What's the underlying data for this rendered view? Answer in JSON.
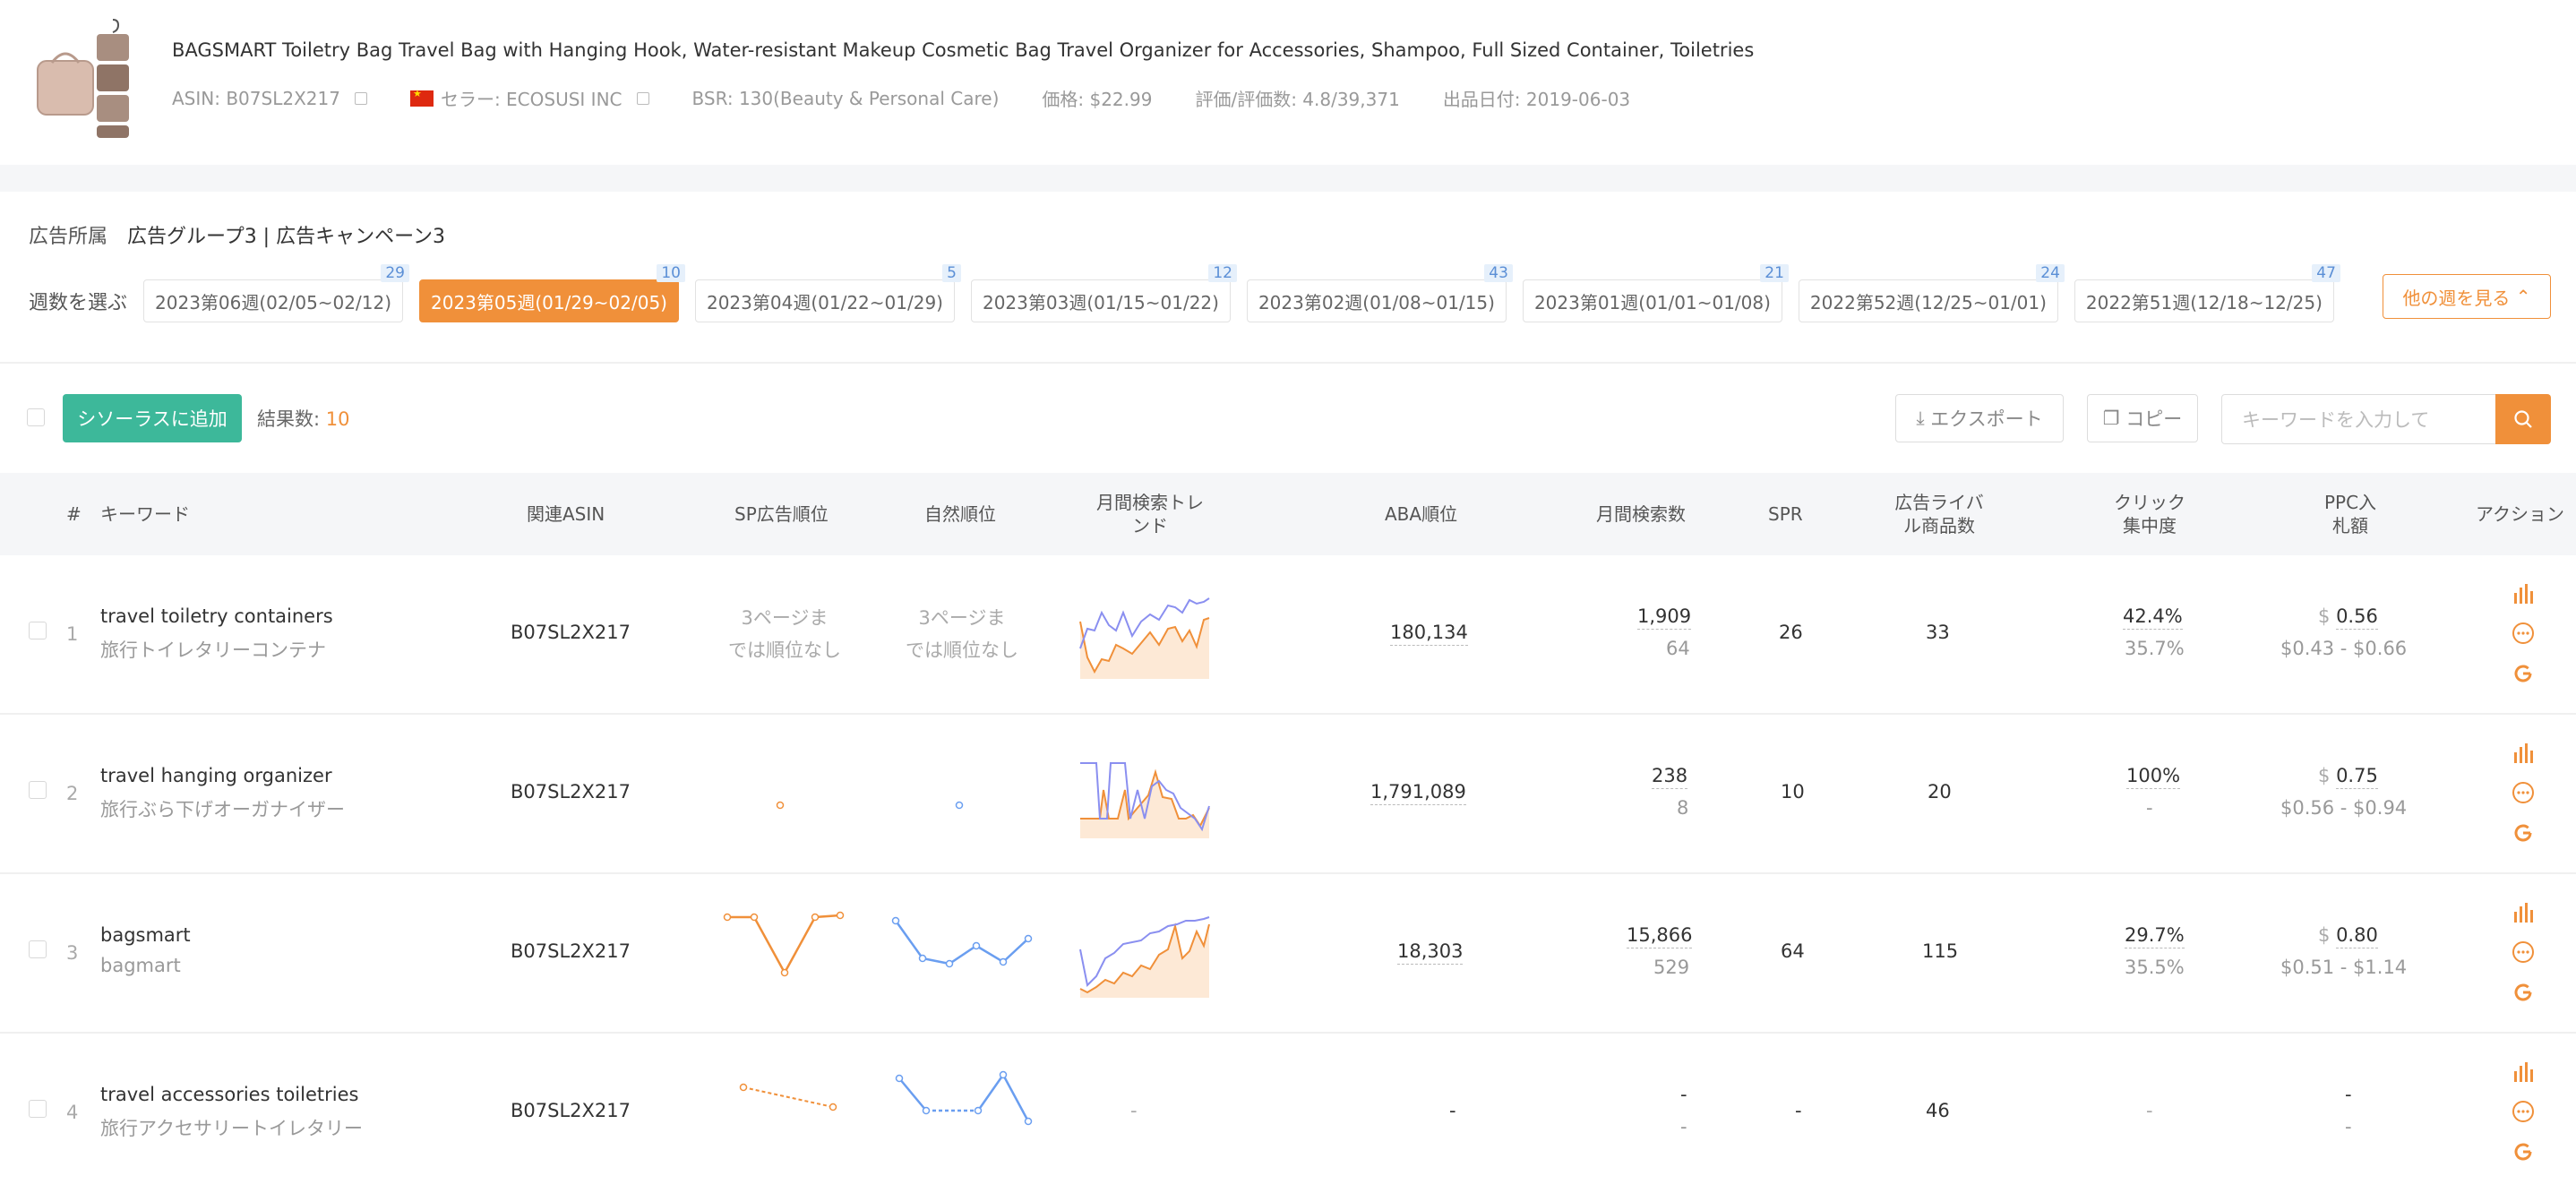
{
  "product": {
    "title": "BAGSMART Toiletry Bag Travel Bag with Hanging Hook, Water-resistant Makeup Cosmetic Bag Travel Organizer for Accessories, Shampoo, Full Sized Container, Toiletries",
    "asin": "ASIN: B07SL2X217",
    "seller": "セラー: ECOSUSI INC",
    "bsr": "BSR: 130(Beauty & Personal Care)",
    "price": "価格: $22.99",
    "rating": "評価/評価数: 4.8/39,371",
    "date": "出品日付: 2019-06-03"
  },
  "ad": {
    "label": "広告所属",
    "value": "広告グループ3 | 広告キャンペーン3"
  },
  "weeks": {
    "label": "週数を選ぶ",
    "items": [
      {
        "label": "2023第06週(02/05~02/12)",
        "badge": "29"
      },
      {
        "label": "2023第05週(01/29~02/05)",
        "badge": "10"
      },
      {
        "label": "2023第04週(01/22~01/29)",
        "badge": "5"
      },
      {
        "label": "2023第03週(01/15~01/22)",
        "badge": "12"
      },
      {
        "label": "2023第02週(01/08~01/15)",
        "badge": "43"
      },
      {
        "label": "2023第01週(01/01~01/08)",
        "badge": "21"
      },
      {
        "label": "2022第52週(12/25~01/01)",
        "badge": "24"
      },
      {
        "label": "2022第51週(12/18~12/25)",
        "badge": "47"
      }
    ],
    "more": "他の週を見る"
  },
  "toolbar": {
    "add": "シソーラスに追加",
    "count_label": "結果数:",
    "count": "10",
    "export": "エクスポート",
    "copy": "コピー",
    "search_placeholder": "キーワードを入力して"
  },
  "columns": {
    "num": "#",
    "keyword": "キーワード",
    "asin": "関連ASIN",
    "sp": "SP広告順位",
    "natural": "自然順位",
    "trend1": "月間検索トレ",
    "trend2": "ンド",
    "aba": "ABA順位",
    "searches": "月間検索数",
    "spr": "SPR",
    "rival1": "広告ライバ",
    "rival2": "ル商品数",
    "click1": "クリック",
    "click2": "集中度",
    "ppc1": "PPC入",
    "ppc2": "札額",
    "action": "アクション"
  },
  "rows": [
    {
      "num": "1",
      "kw": "travel toiletry containers",
      "kw_jp": "旅行トイレタリーコンテナ",
      "asin": "B07SL2X217",
      "sp1": "3ページま",
      "sp2": "では順位なし",
      "nat1": "3ページま",
      "nat2": "では順位なし",
      "aba": "180,134",
      "search": "1,909",
      "search_sub": "64",
      "spr": "26",
      "rival": "33",
      "click": "42.4%",
      "click_sub": "35.7%",
      "ppc": "0.56",
      "ppc_range": "$0.43 - $0.66"
    },
    {
      "num": "2",
      "kw": "travel hanging organizer",
      "kw_jp": "旅行ぶら下げオーガナイザー",
      "asin": "B07SL2X217",
      "aba": "1,791,089",
      "search": "238",
      "search_sub": "8",
      "spr": "10",
      "rival": "20",
      "click": "100%",
      "click_sub": "-",
      "ppc": "0.75",
      "ppc_range": "$0.56 - $0.94"
    },
    {
      "num": "3",
      "kw": "bagsmart",
      "kw_jp": "bagmart",
      "asin": "B07SL2X217",
      "aba": "18,303",
      "search": "15,866",
      "search_sub": "529",
      "spr": "64",
      "rival": "115",
      "click": "29.7%",
      "click_sub": "35.5%",
      "ppc": "0.80",
      "ppc_range": "$0.51 - $1.14"
    },
    {
      "num": "4",
      "kw": "travel accessories toiletries",
      "kw_jp": "旅行アクセサリートイレタリー",
      "asin": "B07SL2X217",
      "trend": "-",
      "aba": "-",
      "search": "-",
      "search_sub": "-",
      "spr": "-",
      "rival": "46",
      "click": "-",
      "ppc": "-",
      "ppc_sub": "-"
    }
  ],
  "currency": "$",
  "colors": {
    "accent": "#f0903a",
    "green": "#3db89a",
    "blue": "#6a9ef0",
    "purple": "#8a8ff0"
  }
}
